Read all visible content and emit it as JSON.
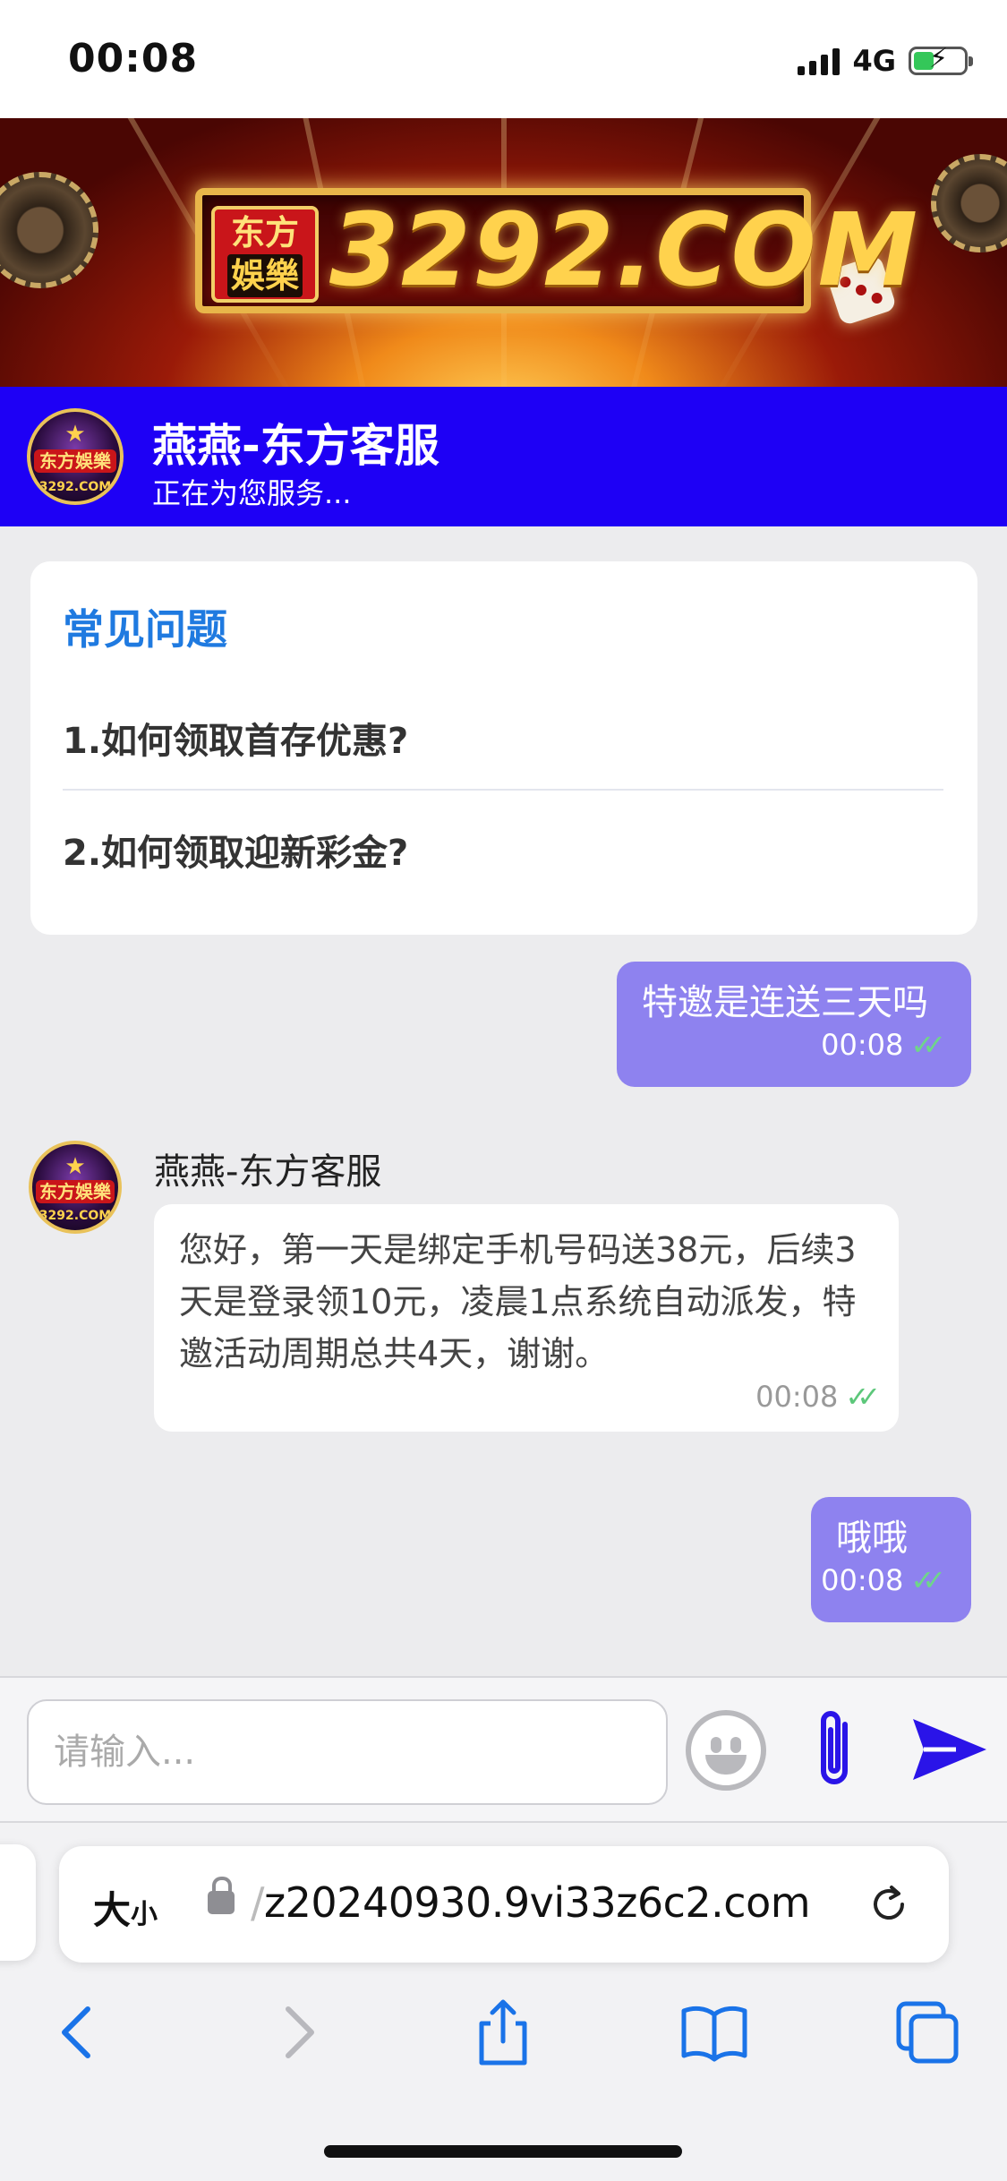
{
  "status_bar": {
    "time": "00:08",
    "network": "4G"
  },
  "banner": {
    "badge_top": "东方",
    "badge_bottom": "娛樂",
    "site": "3292.COM"
  },
  "header": {
    "title": "燕燕-东方客服",
    "subtitle": "正在为您服务..."
  },
  "avatar": {
    "text": "东方娛樂",
    "sub": "3292.COM"
  },
  "faq": {
    "title": "常见问题",
    "items": [
      "1.如何领取首存优惠?",
      "2.如何领取迎新彩金?"
    ]
  },
  "messages": [
    {
      "direction": "out",
      "text": "特邀是连送三天吗",
      "time": "00:08"
    },
    {
      "direction": "in",
      "sender": "燕燕-东方客服",
      "text": "您好，第一天是绑定手机号码送38元，后续3天是登录领10元，凌晨1点系统自动派发，特邀活动周期总共4天，谢谢。",
      "time": "00:08"
    },
    {
      "direction": "out",
      "text": "哦哦",
      "time": "00:08"
    }
  ],
  "input": {
    "placeholder": "请输入..."
  },
  "browser": {
    "text_size_big": "大",
    "text_size_small": "小",
    "url_prefix": "/",
    "url": "z20240930.9vi33z6c2.com"
  },
  "colors": {
    "header_bg": "#1e00f5",
    "out_bubble": "#8e82ef",
    "faq_title": "#1f7ae0",
    "check": "#6fd58a"
  },
  "icons": [
    "signal-icon",
    "battery-icon",
    "emoji-icon",
    "paperclip-icon",
    "send-icon",
    "lock-icon",
    "reload-icon",
    "back-icon",
    "forward-icon",
    "share-icon",
    "bookmarks-icon",
    "tabs-icon"
  ]
}
